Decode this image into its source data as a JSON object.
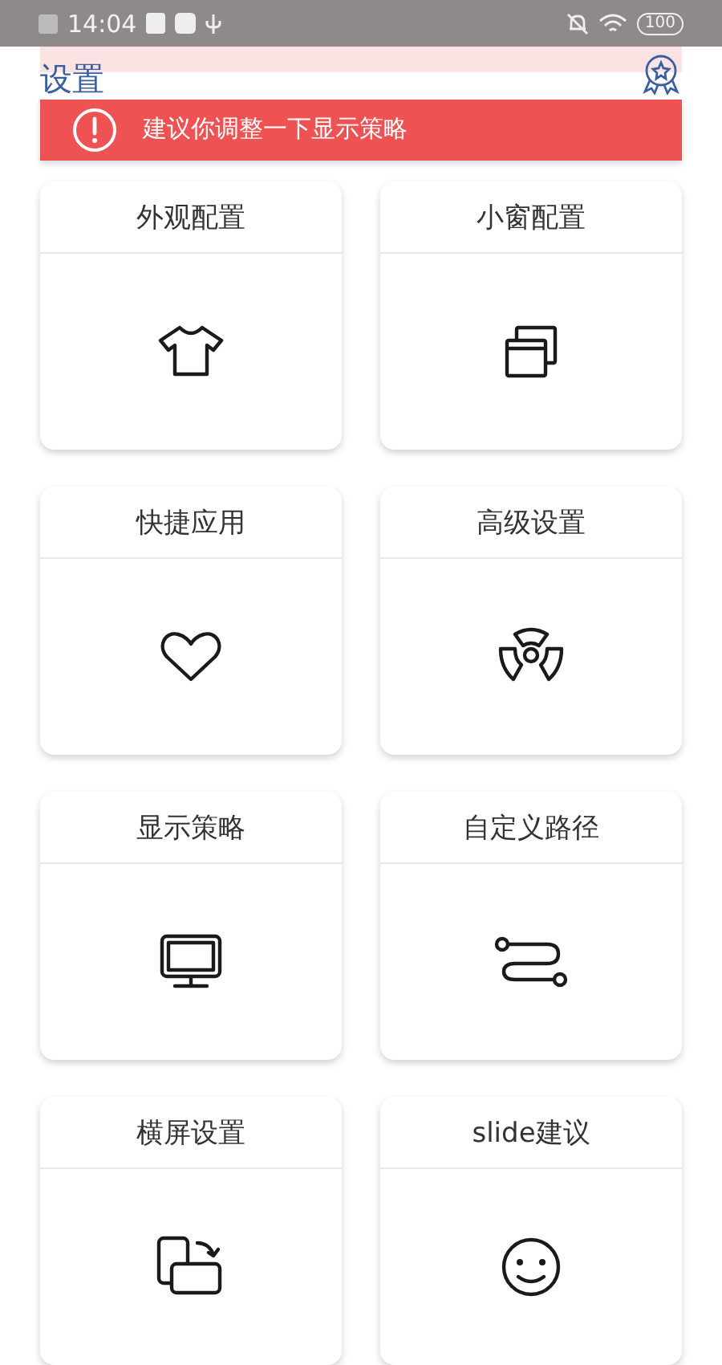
{
  "status_bar": {
    "time": "14:04",
    "battery": "100"
  },
  "header": {
    "title": "设置"
  },
  "alert": {
    "message": "建议你调整一下显示策略"
  },
  "cards": [
    {
      "title": "外观配置"
    },
    {
      "title": "小窗配置"
    },
    {
      "title": "快捷应用"
    },
    {
      "title": "高级设置"
    },
    {
      "title": "显示策略"
    },
    {
      "title": "自定义路径"
    },
    {
      "title": "横屏设置"
    },
    {
      "title": "slide建议"
    }
  ]
}
